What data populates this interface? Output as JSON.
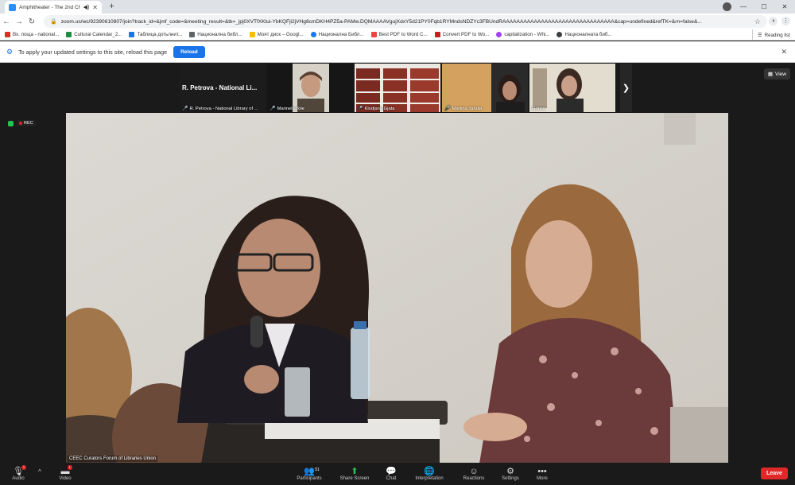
{
  "browser": {
    "tab_title": "Amphitheater - The 2nd Cha",
    "new_tab_symbol": "+",
    "url": "zoom.us/wc/92390610807/join?track_id=&jmf_code=&meeting_result=&tk=_jpj0XVTfXKlui-YbKQFji2jVHg8cmDKH4PZ5a-PAMw.DQMAAAAVgujXdxY5d21PY0Fqb1RYMndsNDZYc3FBUndRAAAAAAAAAAAAAAAAAAAAAAAAAAAAAAAA&cap=undefined&refTK=&rn=false&..."
  },
  "bookmarks": [
    {
      "label": "Вх. поща - national...",
      "color": "#d93025"
    },
    {
      "label": "Cultural Calendar_2...",
      "color": "#1e8e3e"
    },
    {
      "label": "Таблица дотьлнит...",
      "color": "#1a73e8"
    },
    {
      "label": "Национална библ...",
      "color": "#5f6368"
    },
    {
      "label": "Моят диск – Googl...",
      "color": "#fbbc04"
    },
    {
      "label": "Национална Библ...",
      "color": "#1877f2"
    },
    {
      "label": "Best PDF to Word C...",
      "color": "#e8453c"
    },
    {
      "label": "Convert PDF to Wo...",
      "color": "#c5221f"
    },
    {
      "label": "capitalization - Whi...",
      "color": "#a142f4"
    },
    {
      "label": "Националната биб...",
      "color": "#3c4043"
    }
  ],
  "reading_list_label": "Reading list",
  "infobar": {
    "message": "To apply your updated settings to this site, reload this page",
    "button": "Reload"
  },
  "meeting": {
    "view_label": "View",
    "rec_label": "REC",
    "participants_strip": [
      {
        "name": "R. Petrova - National Library of ...",
        "big_label": "R. Petrova - National Li..."
      },
      {
        "name": "Marinela Tole"
      },
      {
        "name": "Klodjana Gjata"
      },
      {
        "name": "Martina Tabula"
      },
      {
        "name": "Gonce"
      }
    ],
    "main_video_label": "CEEC Curators Forum of Libraries Union"
  },
  "zoom_toolbar": {
    "audio": "Audio",
    "video": "Video",
    "participants": "Participants",
    "participants_count": "51",
    "share_screen": "Share Screen",
    "chat": "Chat",
    "interpretation": "Interpretation",
    "reactions": "Reactions",
    "settings": "Settings",
    "more": "More",
    "leave": "Leave"
  }
}
